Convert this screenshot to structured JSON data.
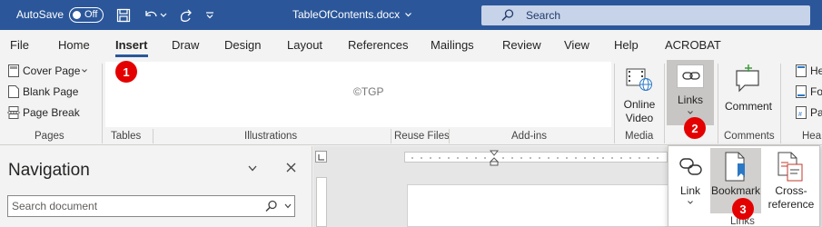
{
  "titlebar": {
    "autosave_label": "AutoSave",
    "autosave_state": "Off",
    "doc_title": "TableOfContents.docx",
    "search_label": "Search",
    "brand_color": "#2b579a"
  },
  "tabs": [
    {
      "label": "File"
    },
    {
      "label": "Home"
    },
    {
      "label": "Insert"
    },
    {
      "label": "Draw"
    },
    {
      "label": "Design"
    },
    {
      "label": "Layout"
    },
    {
      "label": "References"
    },
    {
      "label": "Mailings"
    },
    {
      "label": "Review"
    },
    {
      "label": "View"
    },
    {
      "label": "Help"
    },
    {
      "label": "ACROBAT"
    }
  ],
  "ribbon": {
    "pages": {
      "cover_page": "Cover Page",
      "blank_page": "Blank Page",
      "page_break": "Page Break",
      "label": "Pages"
    },
    "tables_label": "Tables",
    "illustrations_label": "Illustrations",
    "reuse_files_label": "Reuse Files",
    "addins_label": "Add-ins",
    "watermark": "©TGP",
    "online_video_line1": "Online",
    "online_video_line2": "Video",
    "media_label": "Media",
    "links_label": "Links",
    "comment_label": "Comment",
    "comments_label": "Comments",
    "header_partial": [
      "He",
      "Fo",
      "Pa"
    ],
    "header_group_partial": "Hea"
  },
  "badges": [
    "1",
    "2",
    "3"
  ],
  "navigation": {
    "title": "Navigation",
    "search_placeholder": "Search document"
  },
  "links_dropdown": {
    "link": "Link",
    "bookmark": "Bookmark",
    "cross_ref_line1": "Cross-",
    "cross_ref_line2": "reference",
    "group_label": "Links"
  }
}
